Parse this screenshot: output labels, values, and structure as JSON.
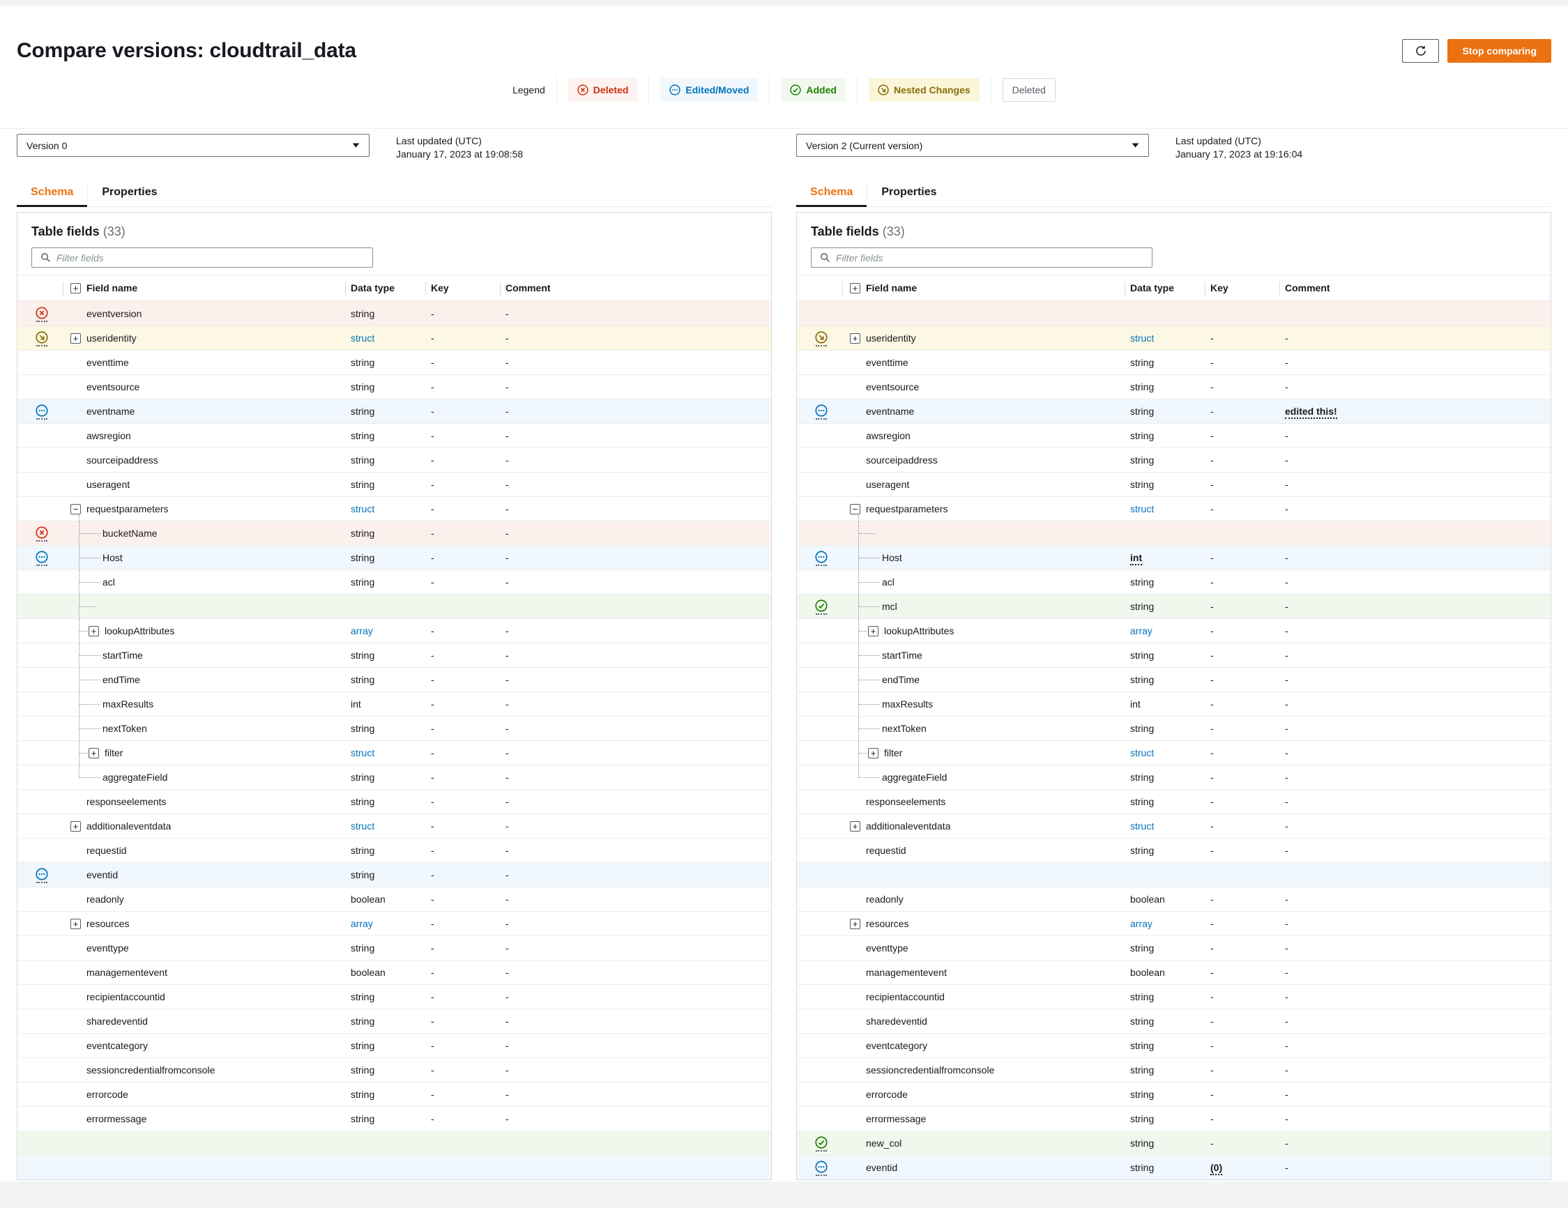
{
  "page": {
    "title": "Compare versions: cloudtrail_data"
  },
  "toolbar": {
    "stop_label": "Stop comparing"
  },
  "legend": {
    "label": "Legend",
    "items": [
      {
        "label": "Deleted",
        "type": "deleted"
      },
      {
        "label": "Edited/Moved",
        "type": "edited"
      },
      {
        "label": "Added",
        "type": "added"
      },
      {
        "label": "Nested Changes",
        "type": "nested"
      },
      {
        "label": "Deleted",
        "type": "plain"
      }
    ]
  },
  "columns_header": {
    "status": "",
    "field_name": "Field name",
    "data_type": "Data type",
    "key": "Key",
    "comment": "Comment"
  },
  "panels": [
    {
      "version_label": "Version 0",
      "updated_label": "Last updated (UTC)",
      "updated_value": "January 17, 2023 at 19:08:58",
      "tabs": [
        {
          "label": "Schema",
          "active": true
        },
        {
          "label": "Properties",
          "active": false
        }
      ],
      "section_title": "Table fields",
      "section_count": "(33)",
      "filter_placeholder": "Filter fields",
      "rows": [
        {
          "name": "eventversion",
          "type": "string",
          "status": "deleted"
        },
        {
          "name": "useridentity",
          "type": "struct",
          "link": true,
          "status": "nested",
          "expand": "plus"
        },
        {
          "name": "eventtime",
          "type": "string"
        },
        {
          "name": "eventsource",
          "type": "string"
        },
        {
          "name": "eventname",
          "type": "string",
          "status": "edited"
        },
        {
          "name": "awsregion",
          "type": "string"
        },
        {
          "name": "sourceipaddress",
          "type": "string"
        },
        {
          "name": "useragent",
          "type": "string"
        },
        {
          "name": "requestparameters",
          "type": "struct",
          "link": true,
          "expand": "minus",
          "tree": "start"
        },
        {
          "name": "bucketName",
          "type": "string",
          "status": "deleted",
          "tree": "child"
        },
        {
          "name": "Host",
          "type": "string",
          "status": "edited",
          "tree": "child"
        },
        {
          "name": "acl",
          "type": "string",
          "tree": "child"
        },
        {
          "empty": true,
          "bg": "added",
          "tree": "child",
          "stub": true
        },
        {
          "name": "lookupAttributes",
          "type": "array",
          "link": true,
          "expand": "plus",
          "tree": "child"
        },
        {
          "name": "startTime",
          "type": "string",
          "tree": "child"
        },
        {
          "name": "endTime",
          "type": "string",
          "tree": "child"
        },
        {
          "name": "maxResults",
          "type": "int",
          "tree": "child"
        },
        {
          "name": "nextToken",
          "type": "string",
          "tree": "child"
        },
        {
          "name": "filter",
          "type": "struct",
          "link": true,
          "expand": "plus",
          "tree": "child"
        },
        {
          "name": "aggregateField",
          "type": "string",
          "tree": "last"
        },
        {
          "name": "responseelements",
          "type": "string"
        },
        {
          "name": "additionaleventdata",
          "type": "struct",
          "link": true,
          "expand": "plus"
        },
        {
          "name": "requestid",
          "type": "string"
        },
        {
          "name": "eventid",
          "type": "string",
          "status": "edited"
        },
        {
          "name": "readonly",
          "type": "boolean"
        },
        {
          "name": "resources",
          "type": "array",
          "link": true,
          "expand": "plus"
        },
        {
          "name": "eventtype",
          "type": "string"
        },
        {
          "name": "managementevent",
          "type": "boolean"
        },
        {
          "name": "recipientaccountid",
          "type": "string"
        },
        {
          "name": "sharedeventid",
          "type": "string"
        },
        {
          "name": "eventcategory",
          "type": "string"
        },
        {
          "name": "sessioncredentialfromconsole",
          "type": "string"
        },
        {
          "name": "errorcode",
          "type": "string"
        },
        {
          "name": "errormessage",
          "type": "string"
        },
        {
          "empty": true,
          "bg": "added"
        },
        {
          "empty": true,
          "bg": "edited"
        }
      ]
    },
    {
      "version_label": "Version 2 (Current version)",
      "updated_label": "Last updated (UTC)",
      "updated_value": "January 17, 2023 at 19:16:04",
      "tabs": [
        {
          "label": "Schema",
          "active": true
        },
        {
          "label": "Properties",
          "active": false
        }
      ],
      "section_title": "Table fields",
      "section_count": "(33)",
      "filter_placeholder": "Filter fields",
      "rows": [
        {
          "empty": true,
          "bg": "deleted"
        },
        {
          "name": "useridentity",
          "type": "struct",
          "link": true,
          "status": "nested",
          "expand": "plus"
        },
        {
          "name": "eventtime",
          "type": "string"
        },
        {
          "name": "eventsource",
          "type": "string"
        },
        {
          "name": "eventname",
          "type": "string",
          "status": "edited",
          "comment": "edited this!",
          "comment_mark": true
        },
        {
          "name": "awsregion",
          "type": "string"
        },
        {
          "name": "sourceipaddress",
          "type": "string"
        },
        {
          "name": "useragent",
          "type": "string"
        },
        {
          "name": "requestparameters",
          "type": "struct",
          "link": true,
          "expand": "minus",
          "tree": "start"
        },
        {
          "empty": true,
          "bg": "deleted",
          "tree": "child",
          "stub": true
        },
        {
          "name": "Host",
          "type": "int",
          "status": "edited",
          "tree": "child",
          "type_mark": true
        },
        {
          "name": "acl",
          "type": "string",
          "tree": "child"
        },
        {
          "name": "mcl",
          "type": "string",
          "status": "added",
          "tree": "child"
        },
        {
          "name": "lookupAttributes",
          "type": "array",
          "link": true,
          "expand": "plus",
          "tree": "child"
        },
        {
          "name": "startTime",
          "type": "string",
          "tree": "child"
        },
        {
          "name": "endTime",
          "type": "string",
          "tree": "child"
        },
        {
          "name": "maxResults",
          "type": "int",
          "tree": "child"
        },
        {
          "name": "nextToken",
          "type": "string",
          "tree": "child"
        },
        {
          "name": "filter",
          "type": "struct",
          "link": true,
          "expand": "plus",
          "tree": "child"
        },
        {
          "name": "aggregateField",
          "type": "string",
          "tree": "last"
        },
        {
          "name": "responseelements",
          "type": "string"
        },
        {
          "name": "additionaleventdata",
          "type": "struct",
          "link": true,
          "expand": "plus"
        },
        {
          "name": "requestid",
          "type": "string"
        },
        {
          "empty": true,
          "bg": "edited"
        },
        {
          "name": "readonly",
          "type": "boolean"
        },
        {
          "name": "resources",
          "type": "array",
          "link": true,
          "expand": "plus"
        },
        {
          "name": "eventtype",
          "type": "string"
        },
        {
          "name": "managementevent",
          "type": "boolean"
        },
        {
          "name": "recipientaccountid",
          "type": "string"
        },
        {
          "name": "sharedeventid",
          "type": "string"
        },
        {
          "name": "eventcategory",
          "type": "string"
        },
        {
          "name": "sessioncredentialfromconsole",
          "type": "string"
        },
        {
          "name": "errorcode",
          "type": "string"
        },
        {
          "name": "errormessage",
          "type": "string"
        },
        {
          "name": "new_col",
          "type": "string",
          "status": "added"
        },
        {
          "name": "eventid",
          "type": "string",
          "status": "edited",
          "key": "(0)",
          "key_mark": true
        }
      ]
    }
  ],
  "colors": {
    "deleted": "#d13212",
    "edited": "#0073bb",
    "added": "#1d8102",
    "nested": "#8a6d0b",
    "accent_button": "#ec7211",
    "link": "#0073bb",
    "active_tab": "#ec7211"
  }
}
